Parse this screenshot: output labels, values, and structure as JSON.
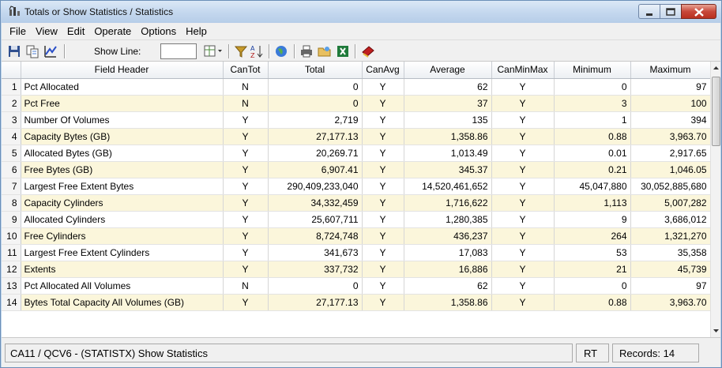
{
  "window": {
    "title": "Totals or Show Statistics / Statistics"
  },
  "menu": [
    "File",
    "View",
    "Edit",
    "Operate",
    "Options",
    "Help"
  ],
  "toolbar": {
    "show_line_label": "Show Line:",
    "show_line_value": "",
    "icons": [
      "save-icon",
      "copy-icon",
      "chart-icon",
      "layout-icon",
      "filter-icon",
      "sort-az-icon",
      "globe-icon",
      "print-icon",
      "folder-icon",
      "excel-icon",
      "book-icon"
    ]
  },
  "table": {
    "columns": [
      "Field Header",
      "CanTot",
      "Total",
      "CanAvg",
      "Average",
      "CanMinMax",
      "Minimum",
      "Maximum"
    ],
    "rows": [
      {
        "n": "1",
        "field": "Pct Allocated",
        "cantot": "N",
        "total": "0",
        "canavg": "Y",
        "average": "62",
        "canminmax": "Y",
        "minimum": "0",
        "maximum": "97"
      },
      {
        "n": "2",
        "field": "Pct Free",
        "cantot": "N",
        "total": "0",
        "canavg": "Y",
        "average": "37",
        "canminmax": "Y",
        "minimum": "3",
        "maximum": "100"
      },
      {
        "n": "3",
        "field": "Number Of Volumes",
        "cantot": "Y",
        "total": "2,719",
        "canavg": "Y",
        "average": "135",
        "canminmax": "Y",
        "minimum": "1",
        "maximum": "394"
      },
      {
        "n": "4",
        "field": "Capacity Bytes (GB)",
        "cantot": "Y",
        "total": "27,177.13",
        "canavg": "Y",
        "average": "1,358.86",
        "canminmax": "Y",
        "minimum": "0.88",
        "maximum": "3,963.70"
      },
      {
        "n": "5",
        "field": "Allocated Bytes (GB)",
        "cantot": "Y",
        "total": "20,269.71",
        "canavg": "Y",
        "average": "1,013.49",
        "canminmax": "Y",
        "minimum": "0.01",
        "maximum": "2,917.65"
      },
      {
        "n": "6",
        "field": "Free Bytes (GB)",
        "cantot": "Y",
        "total": "6,907.41",
        "canavg": "Y",
        "average": "345.37",
        "canminmax": "Y",
        "minimum": "0.21",
        "maximum": "1,046.05"
      },
      {
        "n": "7",
        "field": "Largest Free Extent Bytes",
        "cantot": "Y",
        "total": "290,409,233,040",
        "canavg": "Y",
        "average": "14,520,461,652",
        "canminmax": "Y",
        "minimum": "45,047,880",
        "maximum": "30,052,885,680"
      },
      {
        "n": "8",
        "field": "Capacity Cylinders",
        "cantot": "Y",
        "total": "34,332,459",
        "canavg": "Y",
        "average": "1,716,622",
        "canminmax": "Y",
        "minimum": "1,113",
        "maximum": "5,007,282"
      },
      {
        "n": "9",
        "field": "Allocated Cylinders",
        "cantot": "Y",
        "total": "25,607,711",
        "canavg": "Y",
        "average": "1,280,385",
        "canminmax": "Y",
        "minimum": "9",
        "maximum": "3,686,012"
      },
      {
        "n": "10",
        "field": "Free Cylinders",
        "cantot": "Y",
        "total": "8,724,748",
        "canavg": "Y",
        "average": "436,237",
        "canminmax": "Y",
        "minimum": "264",
        "maximum": "1,321,270"
      },
      {
        "n": "11",
        "field": "Largest Free Extent Cylinders",
        "cantot": "Y",
        "total": "341,673",
        "canavg": "Y",
        "average": "17,083",
        "canminmax": "Y",
        "minimum": "53",
        "maximum": "35,358"
      },
      {
        "n": "12",
        "field": "Extents",
        "cantot": "Y",
        "total": "337,732",
        "canavg": "Y",
        "average": "16,886",
        "canminmax": "Y",
        "minimum": "21",
        "maximum": "45,739"
      },
      {
        "n": "13",
        "field": "Pct Allocated All Volumes",
        "cantot": "N",
        "total": "0",
        "canavg": "Y",
        "average": "62",
        "canminmax": "Y",
        "minimum": "0",
        "maximum": "97"
      },
      {
        "n": "14",
        "field": "Bytes Total Capacity All Volumes (GB)",
        "cantot": "Y",
        "total": "27,177.13",
        "canavg": "Y",
        "average": "1,358.86",
        "canminmax": "Y",
        "minimum": "0.88",
        "maximum": "3,963.70"
      }
    ]
  },
  "status": {
    "main": "CA11 / QCV6 - (STATISTX) Show Statistics",
    "mode": "RT",
    "records": "Records: 14"
  },
  "colors": {
    "alt_row": "#fbf6db",
    "window_frame": "#bcd4ec",
    "close_button": "#c8483a"
  }
}
